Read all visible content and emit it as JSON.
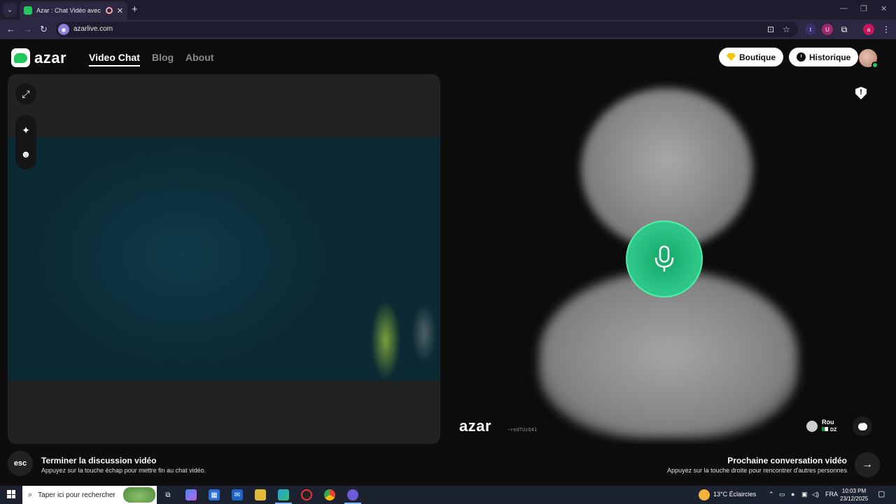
{
  "browser": {
    "tab_title": "Azar : Chat Vidéo avec de n",
    "url": "azarlive.com"
  },
  "header": {
    "logo_text": "azar",
    "nav": [
      "Video Chat",
      "Blog",
      "About"
    ],
    "boutique_label": "Boutique",
    "historique_label": "Historique"
  },
  "partner": {
    "watermark": "azar",
    "watermark_id": "~redTUzQ41",
    "name": "Rou",
    "country": "DZ"
  },
  "hints": {
    "esc_key": "esc",
    "end_title": "Terminer la discussion vidéo",
    "end_sub": "Appuyez sur la touche échap pour mettre fin au chat vidéo.",
    "next_title": "Prochaine conversation vidéo",
    "next_sub": "Appuyez sur la touche droite pour rencontrer d'autres personnes"
  },
  "taskbar": {
    "search_placeholder": "Taper ici pour rechercher",
    "weather": "13°C  Éclaircies",
    "language": "FRA",
    "time": "10:03 PM",
    "date": "23/12/2025"
  },
  "colors": {
    "accent_green": "#22c55e",
    "mic_green": "#2cc487"
  }
}
